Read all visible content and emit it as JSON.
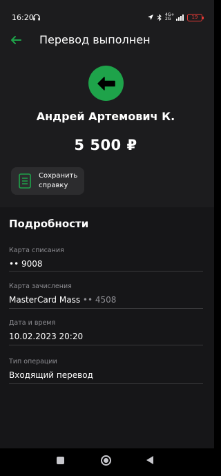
{
  "status_bar": {
    "time": "16:20",
    "network": "4G+ 2G",
    "battery": "19",
    "battery_color": "#e53935"
  },
  "header": {
    "title": "Перевод выполнен",
    "back_icon": "arrow-left-icon",
    "accent": "#1ea34a"
  },
  "transfer": {
    "recipient": "Андрей Артемович К.",
    "amount": "5 500 ₽",
    "icon": "arrow-left-in-circle-icon"
  },
  "actions": {
    "save_receipt": "Сохранить справку"
  },
  "details": {
    "title": "Подробности",
    "fields": [
      {
        "label": "Карта списания",
        "value": "•• 9008",
        "value_extra": ""
      },
      {
        "label": "Карта зачисления",
        "value": "MasterCard Mass",
        "value_extra": "•• 4508"
      },
      {
        "label": "Дата и время",
        "value": "10.02.2023 20:20",
        "value_extra": ""
      },
      {
        "label": "Тип операции",
        "value": "Входящий перевод",
        "value_extra": ""
      }
    ]
  },
  "nav": {
    "recents": "square-icon",
    "home": "circle-icon",
    "back": "triangle-back-icon"
  }
}
